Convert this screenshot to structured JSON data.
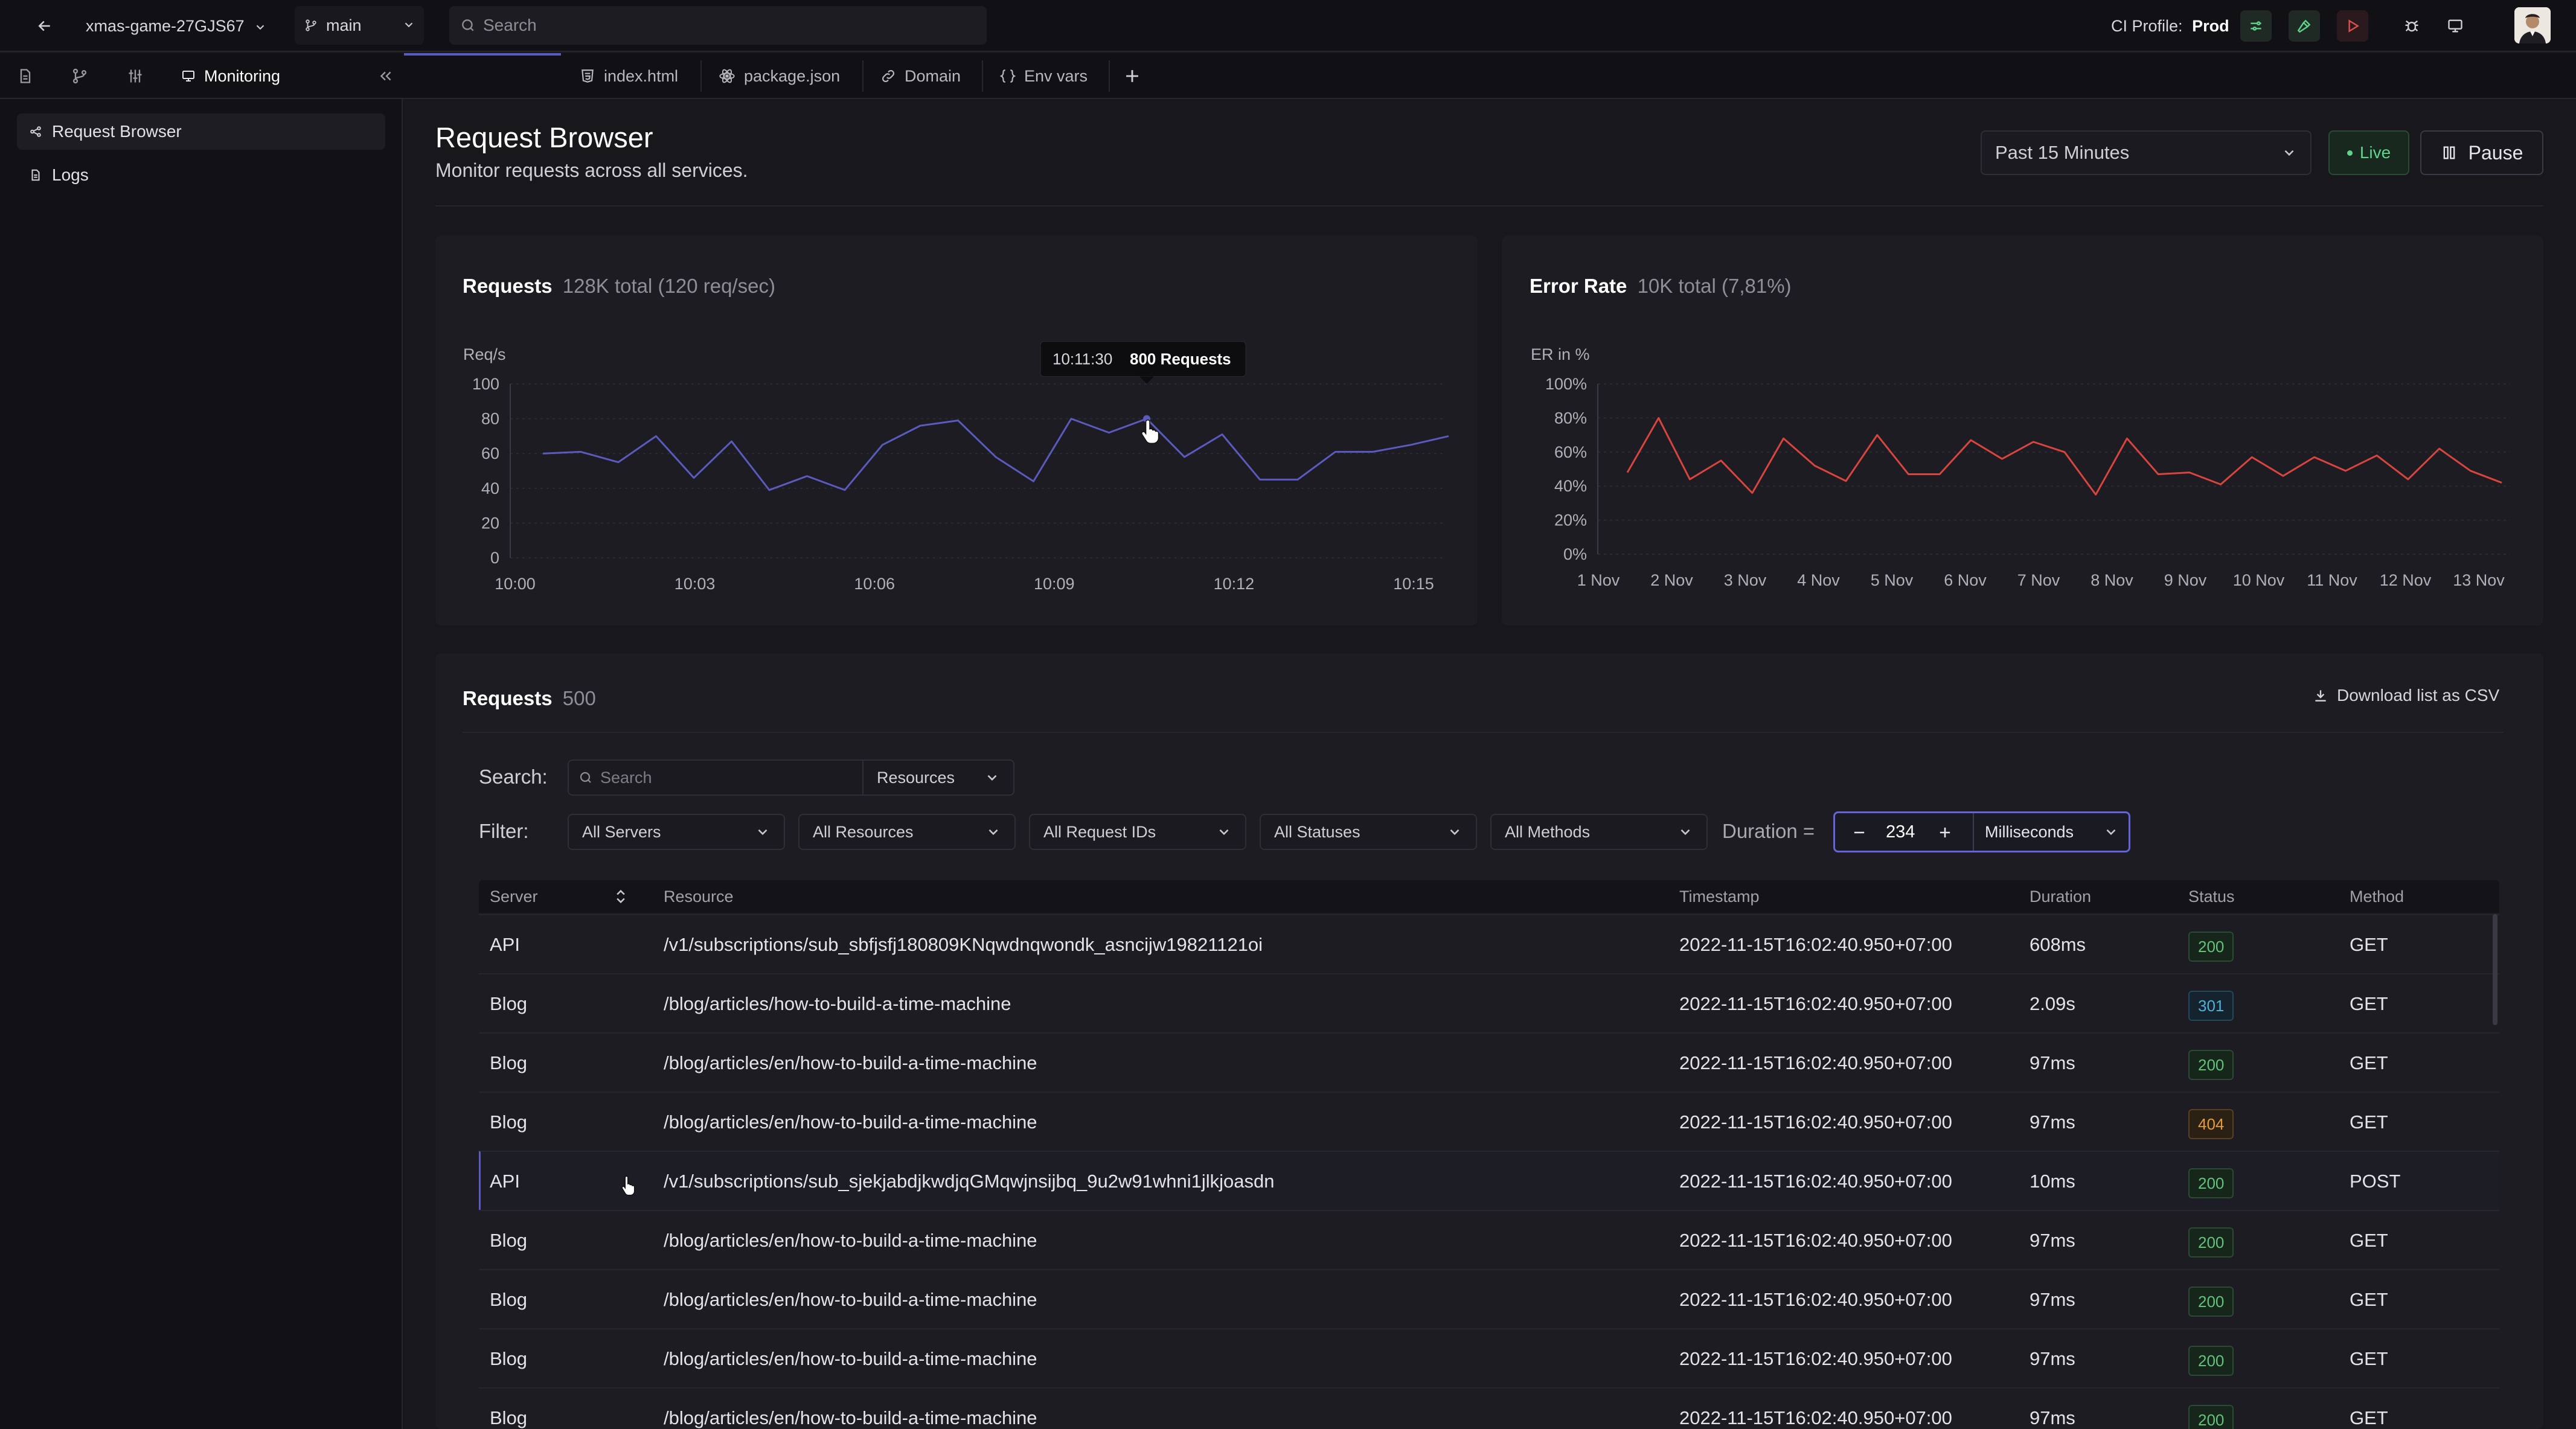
{
  "topbar": {
    "project": "xmas-game-27GJS67",
    "branch": "main",
    "search_placeholder": "Search",
    "ci_label": "CI Profile:",
    "ci_value": "Prod"
  },
  "tabs": [
    {
      "label": "Monitoring"
    },
    {
      "label": "index.html"
    },
    {
      "label": "package.json"
    },
    {
      "label": "Domain"
    },
    {
      "label": "Env vars"
    }
  ],
  "sidebar": {
    "items": [
      {
        "label": "Request Browser"
      },
      {
        "label": "Logs"
      }
    ]
  },
  "header": {
    "title": "Request Browser",
    "subtitle": "Monitor requests across all services.",
    "time_range": "Past 15 Minutes",
    "live_label": "Live",
    "pause_label": "Pause"
  },
  "requests_chart": {
    "title": "Requests",
    "summary": "128K total (120 req/sec)",
    "ylabel": "Req/s",
    "tooltip_time": "10:11:30",
    "tooltip_value": "800 Requests"
  },
  "error_chart": {
    "title": "Error Rate",
    "summary": "10K total (7,81%)",
    "ylabel": "ER in %"
  },
  "chart_data": [
    {
      "type": "line",
      "title": "Requests",
      "ylabel": "Req/s",
      "color": "#5b5bbf",
      "ylim": [
        0,
        100
      ],
      "yticks": [
        "100",
        "80",
        "60",
        "40",
        "20",
        "0"
      ],
      "xticks": [
        "10:00",
        "10:03",
        "10:06",
        "10:09",
        "10:12",
        "10:15"
      ],
      "values": [
        60,
        61,
        55,
        70,
        46,
        67,
        39,
        47,
        39,
        65,
        76,
        79,
        58,
        44,
        80,
        72,
        80,
        58,
        71,
        45,
        45,
        61,
        61,
        65,
        70
      ]
    },
    {
      "type": "line",
      "title": "Error Rate",
      "ylabel": "ER in %",
      "color": "#d8453f",
      "ylim": [
        0,
        100
      ],
      "yticks": [
        "100%",
        "80%",
        "60%",
        "40%",
        "20%",
        "0%"
      ],
      "xticks": [
        "1 Nov",
        "2 Nov",
        "3 Nov",
        "4 Nov",
        "5 Nov",
        "6 Nov",
        "7 Nov",
        "8 Nov",
        "9 Nov",
        "10 Nov",
        "11 Nov",
        "12 Nov",
        "13 Nov"
      ],
      "values": [
        48,
        80,
        44,
        55,
        36,
        68,
        52,
        43,
        70,
        47,
        47,
        67,
        56,
        66,
        60,
        35,
        68,
        47,
        48,
        41,
        57,
        46,
        57,
        49,
        58,
        44,
        62,
        49,
        42
      ]
    }
  ],
  "table": {
    "title": "Requests",
    "count": "500",
    "download_label": "Download list as CSV",
    "search_label": "Search:",
    "search_placeholder": "Search",
    "search_scope": "Resources",
    "filter_label": "Filter:",
    "filters": [
      "All Servers",
      "All Resources",
      "All Request IDs",
      "All Statuses",
      "All Methods"
    ],
    "duration_label": "Duration =",
    "duration_value": "234",
    "duration_unit": "Milliseconds",
    "columns": [
      "Server",
      "Resource",
      "Timestamp",
      "Duration",
      "Status",
      "Method"
    ],
    "rows": [
      {
        "server": "API",
        "resource": "/v1/subscriptions/sub_sbfjsfj180809KNqwdnqwondk_asncijw19821121oi",
        "timestamp": "2022-11-15T16:02:40.950+07:00",
        "duration": "608ms",
        "status": "200",
        "method": "GET"
      },
      {
        "server": "Blog",
        "resource": "/blog/articles/how-to-build-a-time-machine",
        "timestamp": "2022-11-15T16:02:40.950+07:00",
        "duration": "2.09s",
        "status": "301",
        "method": "GET"
      },
      {
        "server": "Blog",
        "resource": "/blog/articles/en/how-to-build-a-time-machine",
        "timestamp": "2022-11-15T16:02:40.950+07:00",
        "duration": "97ms",
        "status": "200",
        "method": "GET"
      },
      {
        "server": "Blog",
        "resource": "/blog/articles/en/how-to-build-a-time-machine",
        "timestamp": "2022-11-15T16:02:40.950+07:00",
        "duration": "97ms",
        "status": "404",
        "method": "GET"
      },
      {
        "server": "API",
        "resource": "/v1/subscriptions/sub_sjekjabdjkwdjqGMqwjnsijbq_9u2w91whni1jlkjoasdn",
        "timestamp": "2022-11-15T16:02:40.950+07:00",
        "duration": "10ms",
        "status": "200",
        "method": "POST"
      },
      {
        "server": "Blog",
        "resource": "/blog/articles/en/how-to-build-a-time-machine",
        "timestamp": "2022-11-15T16:02:40.950+07:00",
        "duration": "97ms",
        "status": "200",
        "method": "GET"
      },
      {
        "server": "Blog",
        "resource": "/blog/articles/en/how-to-build-a-time-machine",
        "timestamp": "2022-11-15T16:02:40.950+07:00",
        "duration": "97ms",
        "status": "200",
        "method": "GET"
      },
      {
        "server": "Blog",
        "resource": "/blog/articles/en/how-to-build-a-time-machine",
        "timestamp": "2022-11-15T16:02:40.950+07:00",
        "duration": "97ms",
        "status": "200",
        "method": "GET"
      },
      {
        "server": "Blog",
        "resource": "/blog/articles/en/how-to-build-a-time-machine",
        "timestamp": "2022-11-15T16:02:40.950+07:00",
        "duration": "97ms",
        "status": "200",
        "method": "GET"
      }
    ]
  },
  "colors": {
    "accent": "#5b5bbf",
    "error_line": "#d8453f",
    "live_green": "#5fd38a",
    "status_ok": "#62c27a",
    "status_redirect": "#4fb1d9",
    "status_notfound": "#e29a3c"
  }
}
